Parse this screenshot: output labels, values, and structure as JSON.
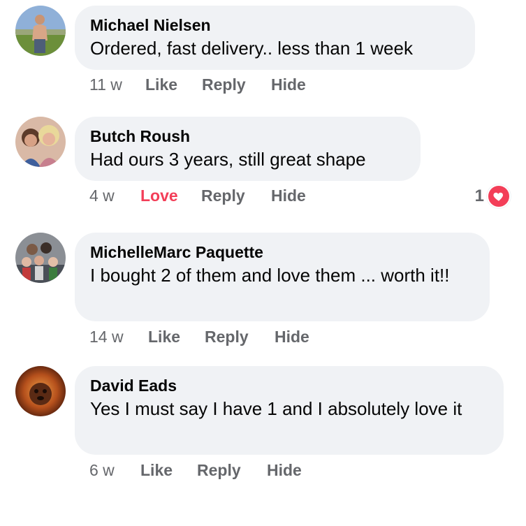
{
  "comments": [
    {
      "author": "Michael Nielsen",
      "text": "Ordered, fast delivery.. less than 1 week",
      "time": "11 w",
      "reaction_action": "Like",
      "reply": "Reply",
      "hide": "Hide",
      "avatar_icon": "person-outdoors-avatar"
    },
    {
      "author": "Butch Roush",
      "text": "Had ours 3 years, still great shape",
      "time": "4 w",
      "reaction_action": "Love",
      "reply": "Reply",
      "hide": "Hide",
      "reaction_count": "1",
      "reaction_icon": "heart-icon",
      "avatar_icon": "couple-avatar"
    },
    {
      "author": "MichelleMarc Paquette",
      "text": "I bought 2 of them and love them ... worth it!!",
      "time": "14 w",
      "reaction_action": "Like",
      "reply": "Reply",
      "hide": "Hide",
      "avatar_icon": "family-avatar"
    },
    {
      "author": "David Eads",
      "text": "Yes I must say I have 1 and I absolutely love it",
      "time": "6 w",
      "reaction_action": "Like",
      "reply": "Reply",
      "hide": "Hide",
      "avatar_icon": "dog-avatar"
    }
  ],
  "colors": {
    "bubble": "#f0f2f5",
    "meta": "#65676b",
    "love": "#f33e58"
  }
}
